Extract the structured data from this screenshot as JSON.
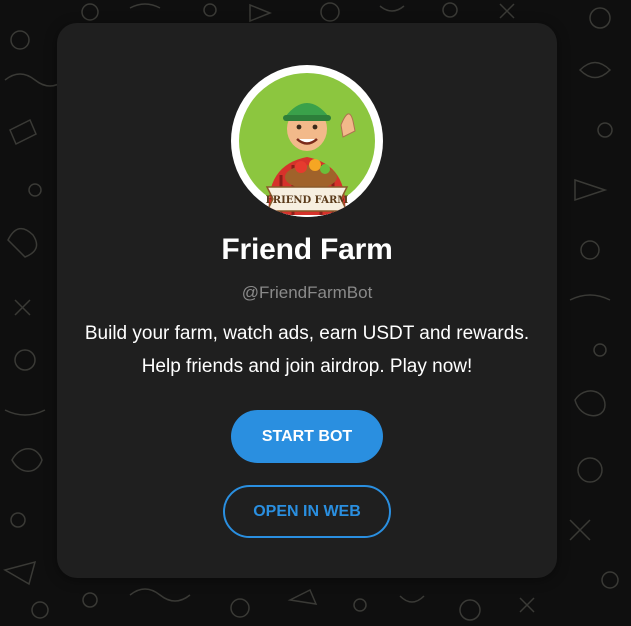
{
  "bot": {
    "name": "Friend Farm",
    "handle": "@FriendFarmBot",
    "description_line1": "Build your farm, watch ads, earn USDT and rewards.",
    "description_line2": "Help friends and join airdrop. Play now!",
    "avatar_label": "FRIEND FARM"
  },
  "actions": {
    "start_label": "START BOT",
    "open_web_label": "OPEN IN WEB"
  },
  "colors": {
    "background": "#0f0f0f",
    "card": "#1f1f1f",
    "accent": "#2a8fe0",
    "muted_text": "#8a8a8a"
  }
}
